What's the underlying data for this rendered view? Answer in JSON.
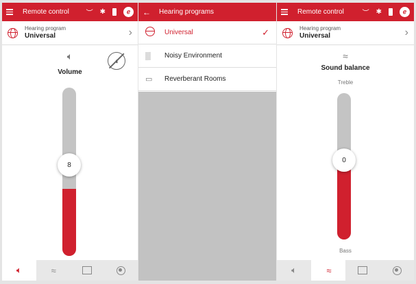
{
  "screen1": {
    "appbar": {
      "title": "Remote control"
    },
    "program": {
      "label": "Hearing program",
      "value": "Universal"
    },
    "control": {
      "title": "Volume",
      "value": "8",
      "level": 0.4
    },
    "nav": [
      "volume-icon",
      "sound-balance-icon",
      "hearing-program-icon",
      "settings-icon"
    ]
  },
  "screen2": {
    "appbar": {
      "title": "Hearing programs"
    },
    "programs": [
      {
        "label": "Universal",
        "selected": true
      },
      {
        "label": "Noisy Environment",
        "selected": false
      },
      {
        "label": "Reverberant Rooms",
        "selected": false
      }
    ]
  },
  "screen3": {
    "appbar": {
      "title": "Remote control"
    },
    "program": {
      "label": "Hearing program",
      "value": "Universal"
    },
    "control": {
      "title": "Sound balance",
      "top_label": "Treble",
      "bottom_label": "Bass",
      "value": "0",
      "level": 0.5
    }
  },
  "colors": {
    "accent": "#d0202e",
    "track": "#c4c4c4",
    "empty": "#c2c2c2"
  }
}
